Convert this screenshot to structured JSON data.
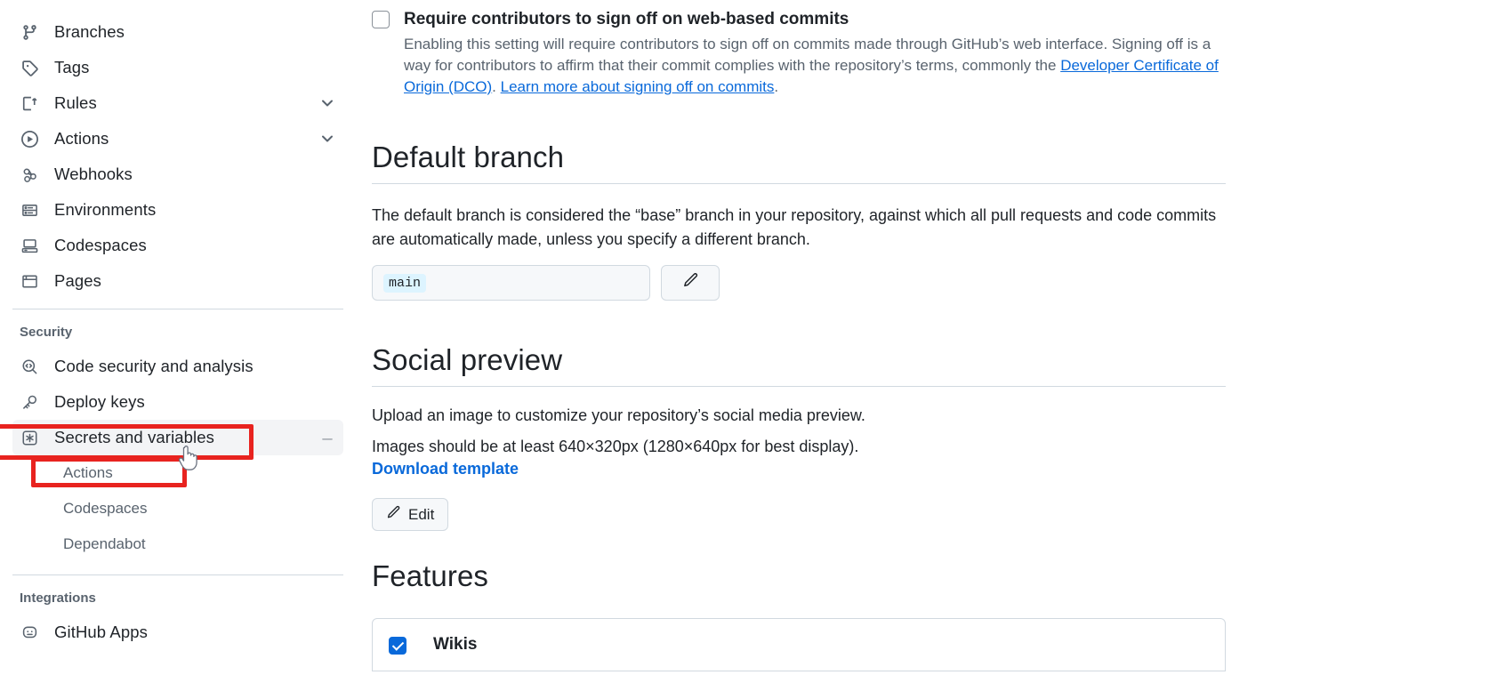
{
  "sidebar": {
    "nav_top": [
      {
        "label": "Branches",
        "icon": "git-branch-icon",
        "chevron": false
      },
      {
        "label": "Tags",
        "icon": "tag-icon",
        "chevron": false
      },
      {
        "label": "Rules",
        "icon": "rules-icon",
        "chevron": true
      },
      {
        "label": "Actions",
        "icon": "play-circle-icon",
        "chevron": true
      },
      {
        "label": "Webhooks",
        "icon": "webhook-icon",
        "chevron": false
      },
      {
        "label": "Environments",
        "icon": "server-icon",
        "chevron": false
      },
      {
        "label": "Codespaces",
        "icon": "codespaces-icon",
        "chevron": false
      },
      {
        "label": "Pages",
        "icon": "browser-icon",
        "chevron": false
      }
    ],
    "security_group_title": "Security",
    "security_items": [
      {
        "label": "Code security and analysis",
        "icon": "code-scan-icon"
      },
      {
        "label": "Deploy keys",
        "icon": "key-icon"
      },
      {
        "label": "Secrets and variables",
        "icon": "asterisk-key-icon",
        "selected": true,
        "collapse_glyph": "⌄"
      }
    ],
    "secrets_subitems": [
      {
        "label": "Actions",
        "highlighted": true
      },
      {
        "label": "Codespaces",
        "highlighted": false
      },
      {
        "label": "Dependabot",
        "highlighted": false
      }
    ],
    "integrations_group_title": "Integrations",
    "integrations_items": [
      {
        "label": "GitHub Apps",
        "icon": "github-app-icon"
      }
    ]
  },
  "annotations": {
    "color": "#e8231f",
    "boxes": [
      {
        "target": "Secrets and variables"
      },
      {
        "target": "Actions"
      }
    ],
    "cursor": "pointer-hand"
  },
  "main": {
    "signoff": {
      "checked": false,
      "title": "Require contributors to sign off on web-based commits",
      "desc_part1": "Enabling this setting will require contributors to sign off on commits made through GitHub’s web interface. Signing off is a way for contributors to affirm that their commit complies with the repository’s terms, commonly the ",
      "link1": "Developer Certificate of Origin (DCO)",
      "desc_part2": ". ",
      "link2": "Learn more about signing off on commits",
      "desc_part3": "."
    },
    "default_branch": {
      "heading": "Default branch",
      "description": "The default branch is considered the “base” branch in your repository, against which all pull requests and code commits are automatically made, unless you specify a different branch.",
      "branch_name": "main",
      "edit_icon": "pencil-icon"
    },
    "social_preview": {
      "heading": "Social preview",
      "line1": "Upload an image to customize your repository’s social media preview.",
      "line2": "Images should be at least 640×320px (1280×640px for best display).",
      "download_link": "Download template",
      "edit_button": "Edit",
      "edit_icon": "pencil-icon"
    },
    "features": {
      "heading": "Features",
      "items": [
        {
          "label": "Wikis",
          "checked": true
        }
      ]
    }
  }
}
